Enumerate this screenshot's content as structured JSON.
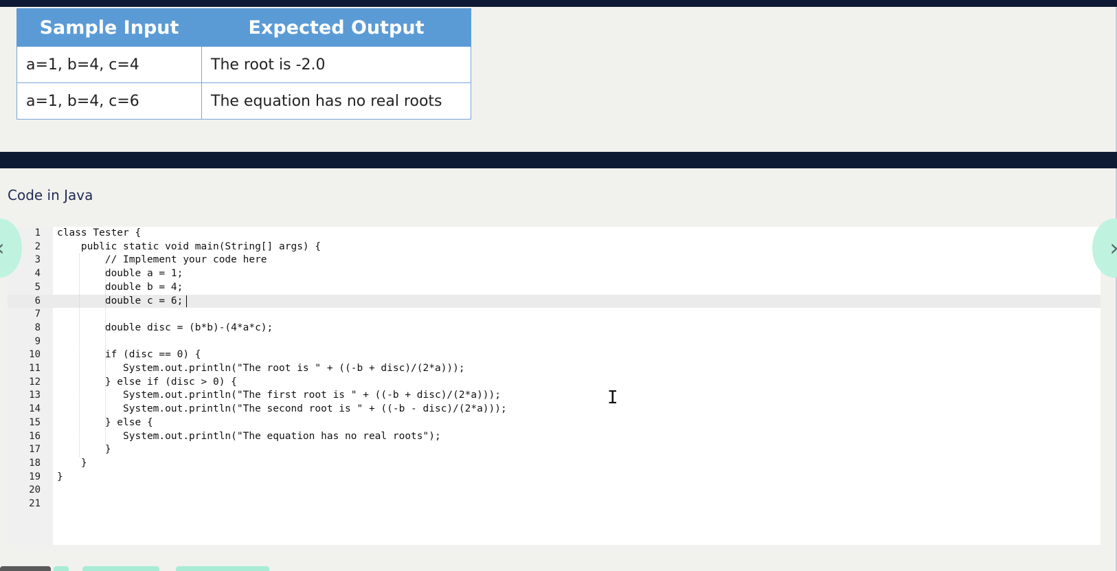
{
  "sample_table": {
    "headers": [
      "Sample Input",
      "Expected Output"
    ],
    "rows": [
      [
        "a=1, b=4, c=4",
        "The root is -2.0"
      ],
      [
        "a=1, b=4, c=6",
        "The equation has no real roots"
      ]
    ]
  },
  "code_section": {
    "title": "Code in Java",
    "active_line": 6,
    "lines": [
      "class Tester {",
      "    public static void main(String[] args) {",
      "        // Implement your code here",
      "        double a = 1;",
      "        double b = 4;",
      "        double c = 6;",
      "",
      "        double disc = (b*b)-(4*a*c);",
      "",
      "        if (disc == 0) {",
      "           System.out.println(\"The root is \" + ((-b + disc)/(2*a)));",
      "        } else if (disc > 0) {",
      "           System.out.println(\"The first root is \" + ((-b + disc)/(2*a)));",
      "           System.out.println(\"The second root is \" + ((-b - disc)/(2*a)));",
      "        } else {",
      "           System.out.println(\"The equation has no real roots\");",
      "        }",
      "    }",
      "}",
      "",
      ""
    ]
  },
  "navigation": {
    "prev_icon": "‹",
    "next_icon": "›"
  },
  "colors": {
    "header_blue": "#5b9bd5",
    "dark_bar": "#0e1a33",
    "nav_mint": "#bff3df",
    "title_navy": "#1f2a55"
  }
}
